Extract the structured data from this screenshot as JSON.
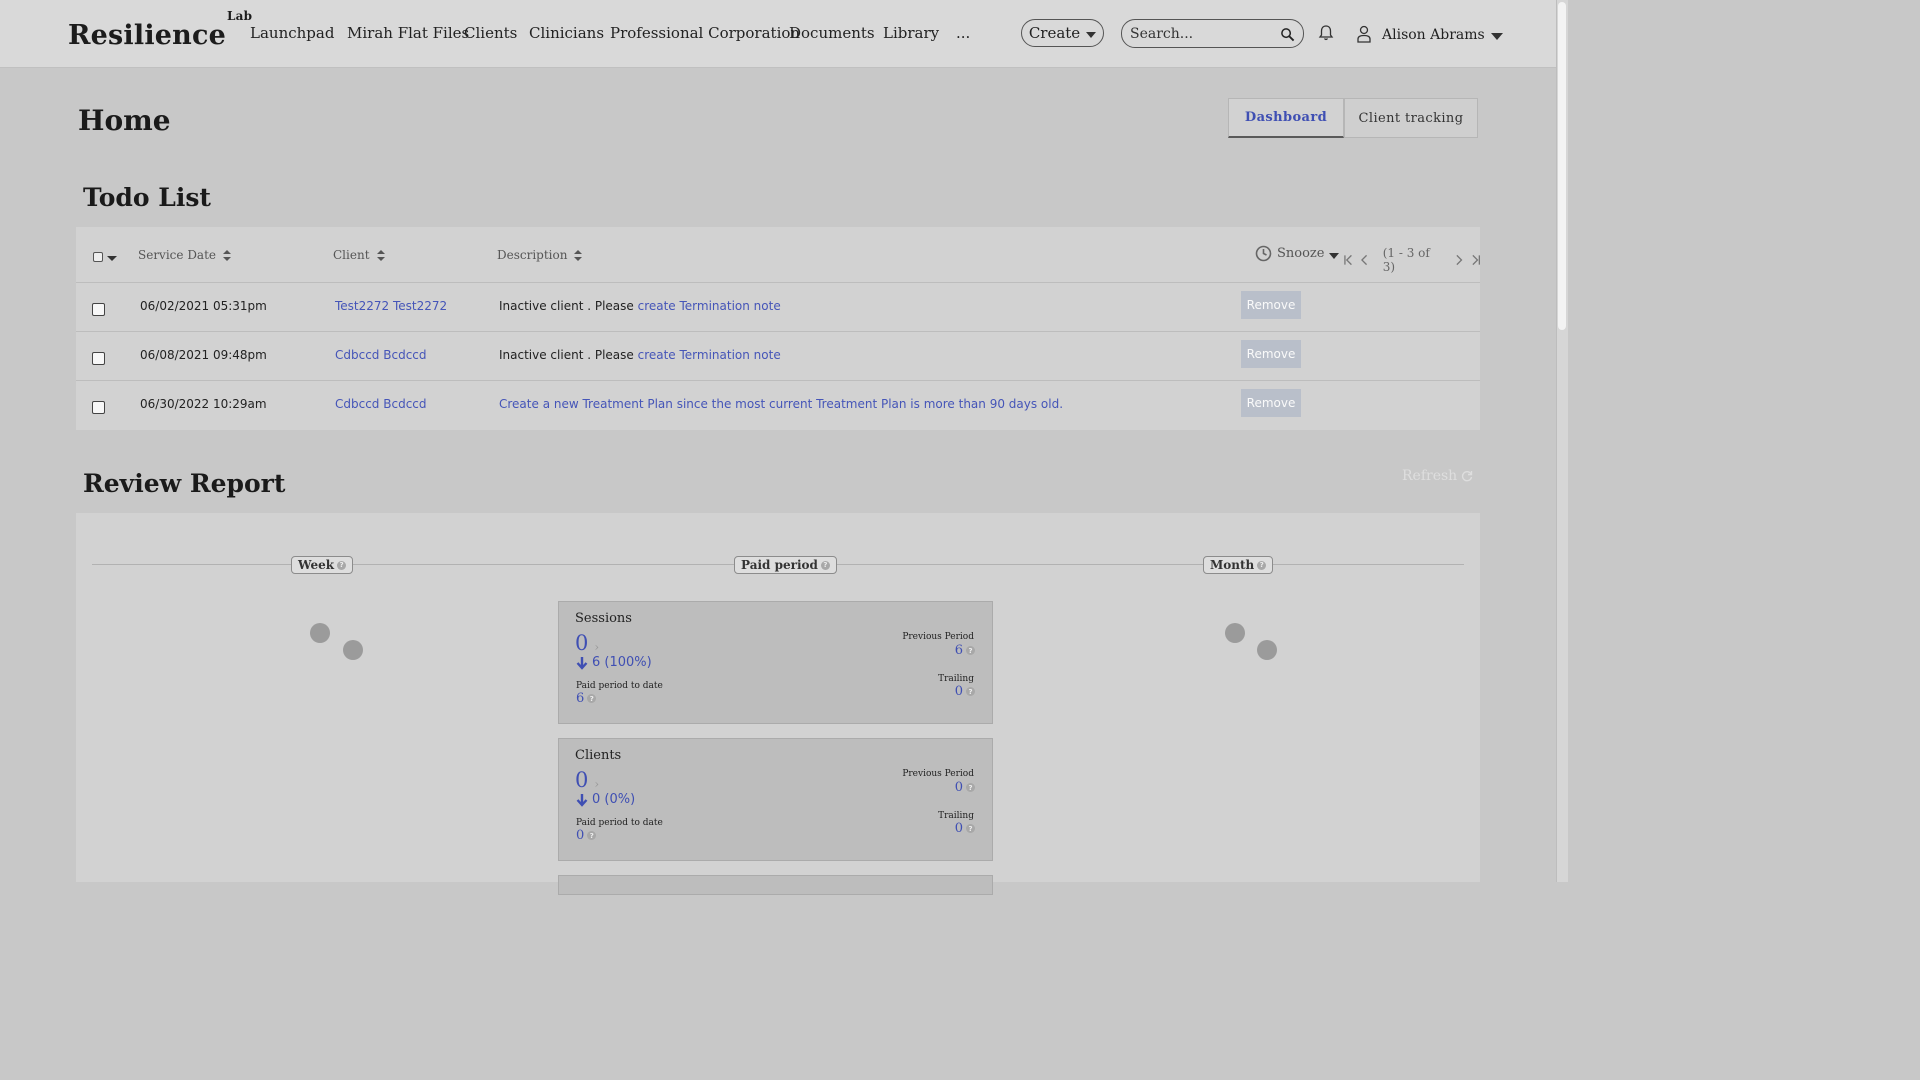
{
  "nav": {
    "logo": "Resilience",
    "logo_sup": "Lab",
    "items": [
      "Launchpad",
      "Mirah Flat Files",
      "Clients",
      "Clinicians",
      "Professional Corporation",
      "Documents",
      "Library",
      "..."
    ],
    "create_label": "Create",
    "search_placeholder": "Search...",
    "user_name": "Alison Abrams"
  },
  "page": {
    "title": "Home",
    "tabs": [
      "Dashboard",
      "Client tracking"
    ],
    "active_tab": "Dashboard"
  },
  "todo": {
    "title": "Todo List",
    "columns": [
      "Service Date",
      "Client",
      "Description"
    ],
    "snooze_label": "Snooze",
    "pager_text": "(1 - 3 of 3)",
    "remove_label": "Remove",
    "rows": [
      {
        "date": "06/02/2021 05:31pm",
        "client": "Test2272 Test2272",
        "desc_prefix": "Inactive client . Please ",
        "desc_link": "create Termination note"
      },
      {
        "date": "06/08/2021 09:48pm",
        "client": "Cdbccd Bcdccd",
        "desc_prefix": "Inactive client . Please ",
        "desc_link": "create Termination note"
      },
      {
        "date": "06/30/2022 10:29am",
        "client": "Cdbccd Bcdccd",
        "desc_prefix": "",
        "desc_link": "Create a new Treatment Plan since the most current Treatment Plan is more than 90 days old."
      }
    ]
  },
  "review": {
    "title": "Review Report",
    "refresh_label": "Refresh",
    "periods": [
      "Week",
      "Paid period",
      "Month"
    ],
    "metrics": [
      {
        "title": "Sessions",
        "value": "0",
        "change": "6 (100%)",
        "to_date_label": "Paid period to date",
        "to_date_value": "6",
        "prev_label": "Previous Period",
        "prev_value": "6",
        "trailing_label": "Trailing",
        "trailing_value": "0"
      },
      {
        "title": "Clients",
        "value": "0",
        "change": "0 (0%)",
        "to_date_label": "Paid period to date",
        "to_date_value": "0",
        "prev_label": "Previous Period",
        "prev_value": "0",
        "trailing_label": "Trailing",
        "trailing_value": "0"
      }
    ]
  },
  "colors": {
    "accent": "#3f4fb3",
    "link": "#4555b8",
    "remove_button": "#b9bfca"
  }
}
